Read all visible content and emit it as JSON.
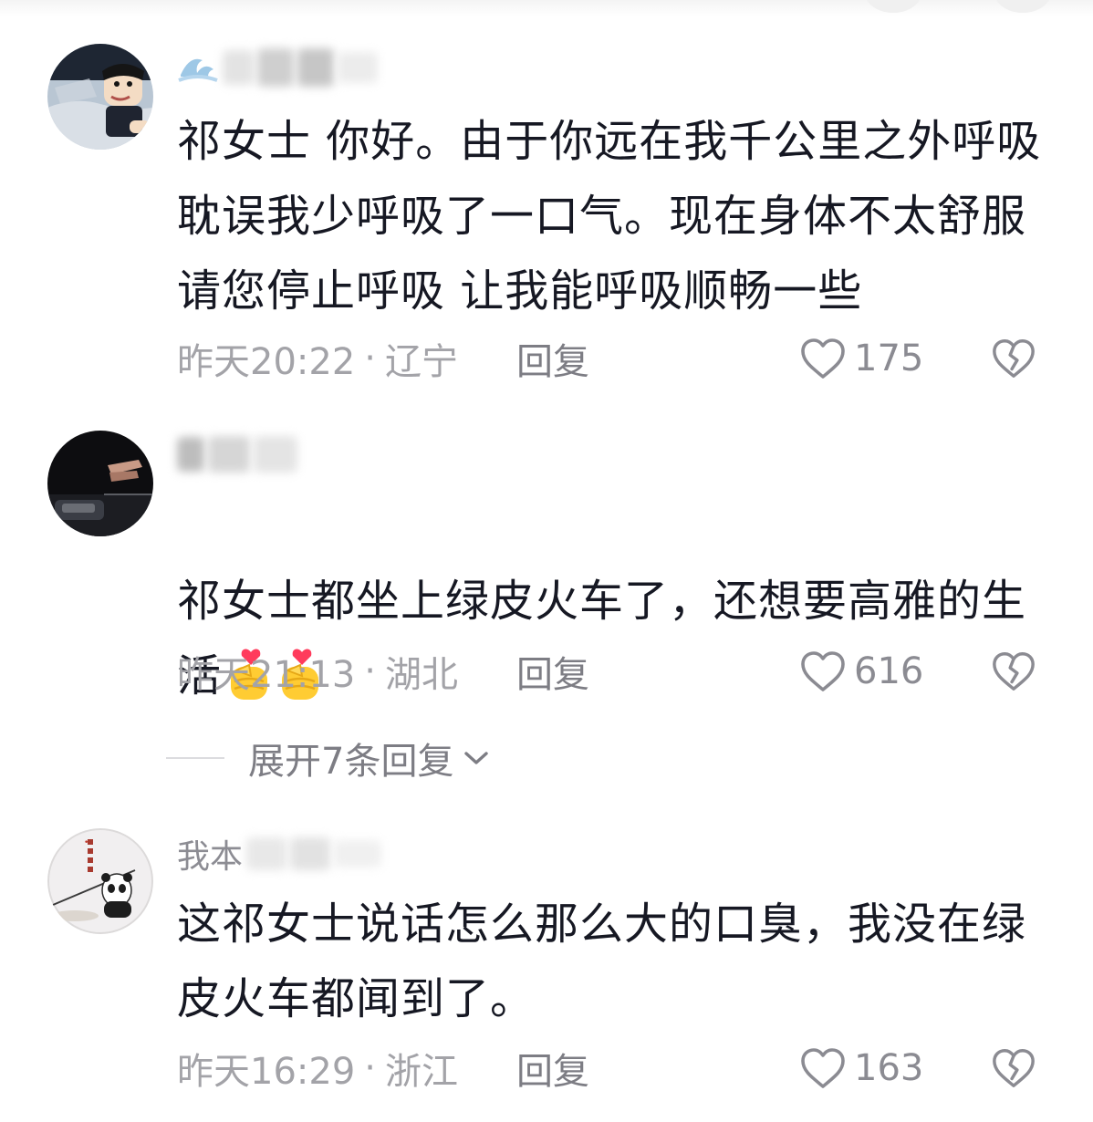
{
  "comments": [
    {
      "username": "",
      "text": "祁女士 你好。由于你远在我千公里之外呼吸\n耽误我少呼吸了一口气。现在身体不太舒服\n请您停止呼吸 让我能呼吸顺畅一些",
      "time": "昨天20:22",
      "separator": "·",
      "location": "辽宁",
      "reply_label": "回复",
      "likes": "175"
    },
    {
      "username": "",
      "text": "祁女士都坐上绿皮火车了，还想要高雅的生\n活",
      "time": "昨天21:13",
      "separator": "·",
      "location": "湖北",
      "reply_label": "回复",
      "likes": "616"
    },
    {
      "username": "我本",
      "text": "这祁女士说话怎么那么大的口臭，我没在绿\n皮火车都闻到了。",
      "time": "昨天16:29",
      "separator": "·",
      "location": "浙江",
      "reply_label": "回复",
      "likes": "163"
    }
  ],
  "expand_replies": {
    "label": "展开7条回复"
  },
  "icons": {
    "like": "heart-outline-icon",
    "dislike": "broken-heart-icon",
    "expand": "chevron-down-icon",
    "emoji": "finger-heart-emoji"
  },
  "colors": {
    "text": "#161823",
    "meta": "#a3a3a8",
    "action": "#7d7d84"
  }
}
